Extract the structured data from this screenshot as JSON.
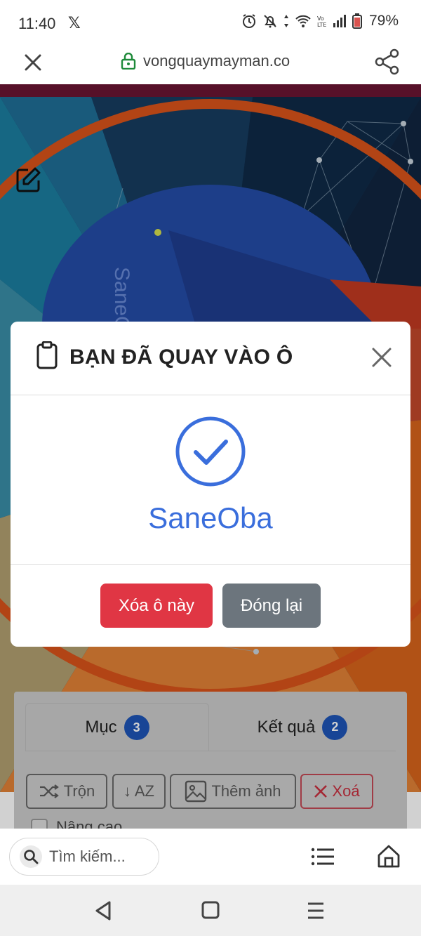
{
  "status_bar": {
    "time": "11:40",
    "x_logo": "𝕏",
    "battery": "79%"
  },
  "browser": {
    "url": "vongquaymayman.co"
  },
  "wheel": {
    "visible_label": "SaneOba"
  },
  "panel": {
    "tabs": [
      {
        "label": "Mục",
        "count": "3"
      },
      {
        "label": "Kết quả",
        "count": "2"
      }
    ],
    "buttons": {
      "shuffle": "Trộn",
      "sort": "↓ AZ",
      "add_image": "Thêm ảnh",
      "delete": "Xoá"
    },
    "advanced": "Nâng cao"
  },
  "modal": {
    "title": "BẠN ĐÃ QUAY VÀO Ô",
    "result": "SaneOba",
    "delete_button": "Xóa ô này",
    "close_button": "Đóng lại"
  },
  "bottom_bar": {
    "search_placeholder": "Tìm kiếm..."
  },
  "colors": {
    "accent_blue": "#3a6edc",
    "danger": "#e03644",
    "secondary": "#6c757d",
    "maroon": "#6b1533",
    "badge": "#1e55b7"
  }
}
